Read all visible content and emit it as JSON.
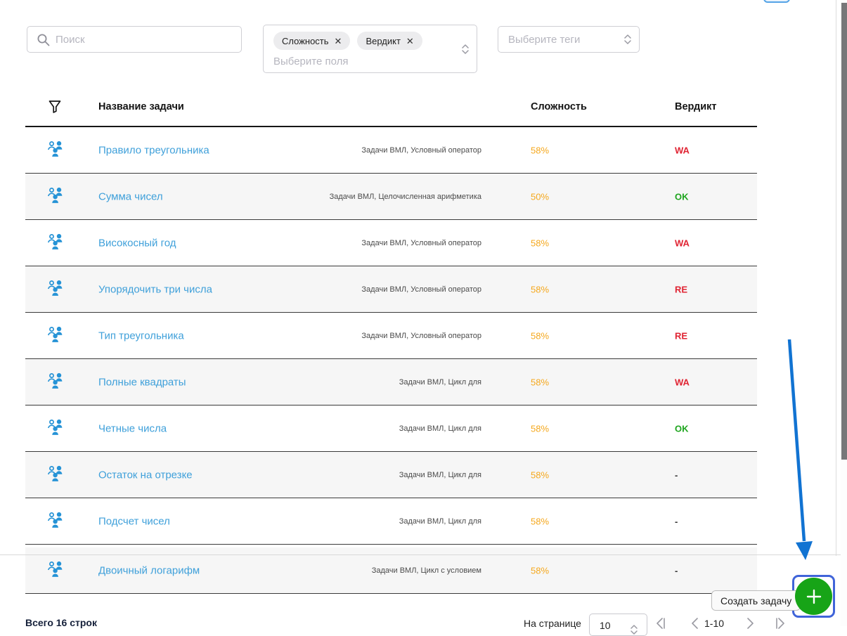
{
  "filters": {
    "search": {
      "placeholder": "Поиск"
    },
    "fields": {
      "placeholder": "Выберите поля",
      "chips": [
        {
          "label": "Сложность"
        },
        {
          "label": "Вердикт"
        }
      ]
    },
    "tags": {
      "placeholder": "Выберите теги"
    }
  },
  "table": {
    "headers": {
      "name": "Название задачи",
      "difficulty": "Сложность",
      "verdict": "Вердикт"
    },
    "rows": [
      {
        "name": "Правило треугольника",
        "tags": "Задачи ВМЛ, Условный оператор",
        "difficulty": "58%",
        "verdict": "WA"
      },
      {
        "name": "Сумма чисел",
        "tags": "Задачи ВМЛ, Целочисленная арифметика",
        "difficulty": "50%",
        "verdict": "OK"
      },
      {
        "name": "Високосный год",
        "tags": "Задачи ВМЛ, Условный оператор",
        "difficulty": "58%",
        "verdict": "WA"
      },
      {
        "name": "Упорядочить три числа",
        "tags": "Задачи ВМЛ, Условный оператор",
        "difficulty": "58%",
        "verdict": "RE"
      },
      {
        "name": "Тип треугольника",
        "tags": "Задачи ВМЛ, Условный оператор",
        "difficulty": "58%",
        "verdict": "RE"
      },
      {
        "name": "Полные квадраты",
        "tags": "Задачи ВМЛ, Цикл для",
        "difficulty": "58%",
        "verdict": "WA"
      },
      {
        "name": "Четные числа",
        "tags": "Задачи ВМЛ, Цикл для",
        "difficulty": "58%",
        "verdict": "OK"
      },
      {
        "name": "Остаток на отрезке",
        "tags": "Задачи ВМЛ, Цикл для",
        "difficulty": "58%",
        "verdict": "-"
      },
      {
        "name": "Подсчет чисел",
        "tags": "Задачи ВМЛ, Цикл для",
        "difficulty": "58%",
        "verdict": "-"
      },
      {
        "name": "Двоичный логарифм",
        "tags": "Задачи ВМЛ, Цикл с условием",
        "difficulty": "58%",
        "verdict": "-"
      }
    ]
  },
  "footer": {
    "total": "Всего 16 строк",
    "per_page_label": "На странице",
    "per_page_value": "10",
    "page_range": "1-10"
  },
  "create_button": {
    "tooltip": "Создать задачу"
  },
  "colors": {
    "link": "#3fa0da",
    "difficulty": "#f5a81d",
    "verdict_ok": "#1ea51e",
    "verdict_bad": "#e02433",
    "verdict_none": "#333333",
    "button_green": "#17a417",
    "focus_ring": "#4064d9",
    "annotation_arrow": "#1173d2"
  }
}
